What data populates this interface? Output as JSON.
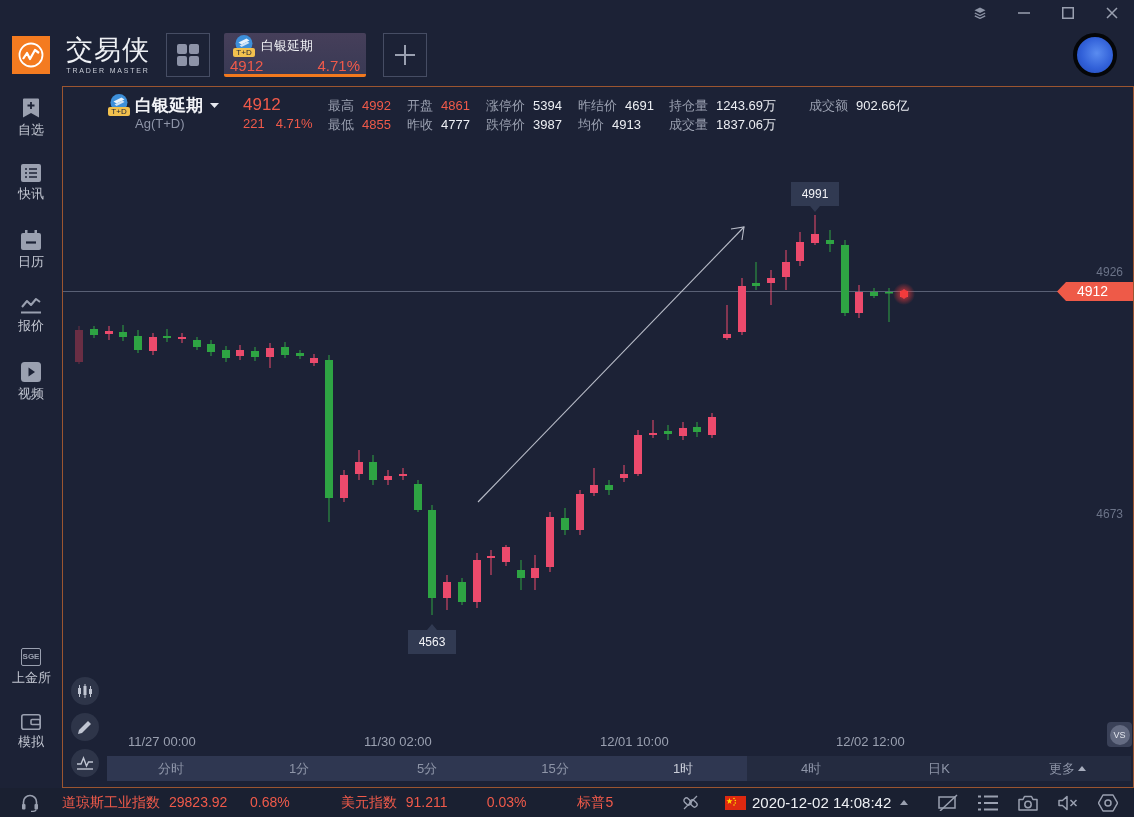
{
  "app": {
    "name": "交易侠",
    "tagline": "TRADER MASTER"
  },
  "open_tabs": [
    {
      "name": "白银延期",
      "badge": "T+D",
      "price": "4912",
      "change": "4.71%",
      "selected": true
    }
  ],
  "sidebar": {
    "items": [
      {
        "label": "自选"
      },
      {
        "label": "快讯"
      },
      {
        "label": "日历"
      },
      {
        "label": "报价"
      },
      {
        "label": "视频"
      }
    ],
    "bottom_items": [
      {
        "label": "上金所",
        "logo": "SGE"
      },
      {
        "label": "模拟"
      }
    ]
  },
  "quote": {
    "name": "白银延期",
    "badge": "T+D",
    "code": "Ag(T+D)",
    "price": "4912",
    "change": "221",
    "change_pct": "4.71%",
    "stats": [
      {
        "label": "最高",
        "value": "4992",
        "highlight": true
      },
      {
        "label": "开盘",
        "value": "4861",
        "highlight": true
      },
      {
        "label": "涨停价",
        "value": "5394",
        "highlight": false
      },
      {
        "label": "昨结价",
        "value": "4691",
        "highlight": false
      },
      {
        "label": "持仓量",
        "value": "1243.69万",
        "highlight": false
      },
      {
        "label": "成交额",
        "value": "902.66亿",
        "highlight": false
      },
      {
        "label": "最低",
        "value": "4855",
        "highlight": true
      },
      {
        "label": "昨收",
        "value": "4777",
        "highlight": false
      },
      {
        "label": "跌停价",
        "value": "3987",
        "highlight": false
      },
      {
        "label": "均价",
        "value": "4913",
        "highlight": false
      },
      {
        "label": "成交量",
        "value": "1837.06万",
        "highlight": false
      }
    ]
  },
  "chart": {
    "price_labels": [
      "4926",
      "4673"
    ],
    "high_marker": "4991",
    "low_marker": "4563",
    "current_price": "4912",
    "time_labels": [
      "11/27 00:00",
      "11/30 02:00",
      "12/01 10:00",
      "12/02 12:00"
    ],
    "compare_button": "VS"
  },
  "periods": [
    {
      "label": "分时",
      "kind": "period",
      "selected": false
    },
    {
      "label": "1分",
      "kind": "period",
      "selected": false
    },
    {
      "label": "5分",
      "kind": "period",
      "selected": false
    },
    {
      "label": "15分",
      "kind": "period",
      "selected": false
    },
    {
      "label": "1时",
      "kind": "period",
      "selected": true
    },
    {
      "label": "4时",
      "kind": "period",
      "selected": false
    },
    {
      "label": "日K",
      "kind": "period",
      "selected": false
    },
    {
      "label": "更多",
      "kind": "menu",
      "selected": false
    }
  ],
  "status_bar": {
    "ticker": [
      {
        "name": "道琼斯工业指数",
        "value": "29823.92",
        "change": "0.68%",
        "up": true
      },
      {
        "name": "美元指数",
        "value": "91.211",
        "change": "0.03%",
        "up": true
      },
      {
        "name": "标普5",
        "up": true
      }
    ],
    "datetime": "2020-12-02 14:08:42"
  }
}
